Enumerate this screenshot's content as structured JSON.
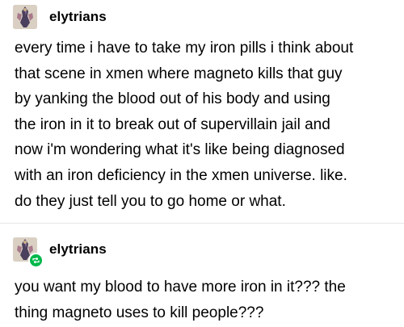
{
  "posts": [
    {
      "username": "elytrians",
      "avatar_icon": "avatar-art-icon",
      "body": "every time i have to take my iron pills i think about\nthat scene in xmen where magneto kills that guy\nby yanking the blood out of his body and using\nthe iron in it to break out of supervillain jail and\nnow i'm wondering what it's like being diagnosed\nwith an iron deficiency in the xmen universe. like.\ndo they just tell you to go home or what."
    },
    {
      "username": "elytrians",
      "avatar_icon": "avatar-art-icon",
      "badge_icon": "reblog-icon",
      "body": "you want my blood to have more iron in it??? the\nthing magneto uses to kill people???"
    }
  ],
  "colors": {
    "reblog_badge": "#00b84a",
    "divider": "#e6e6e6",
    "text": "#000000"
  }
}
